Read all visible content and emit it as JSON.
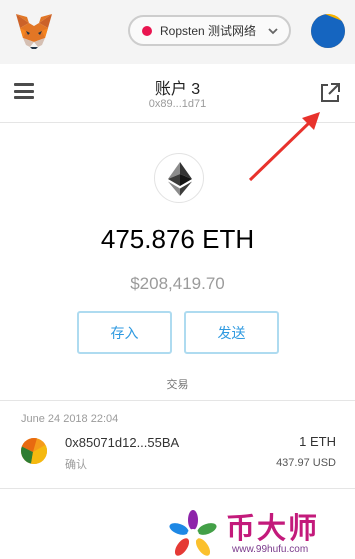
{
  "topbar": {
    "network_label": "Ropsten 测试网络",
    "network_color": "#e91550",
    "fox_icon": "metamask-fox-icon",
    "identicon": "account-identicon"
  },
  "account": {
    "name": "账户 3",
    "address_short": "0x89...1d71"
  },
  "balance": {
    "eth": "475.876 ETH",
    "fiat": "$208,419.70"
  },
  "actions": {
    "deposit_label": "存入",
    "send_label": "发送"
  },
  "transactions": {
    "title": "交易",
    "items": [
      {
        "date": "June 24 2018 22:04",
        "address": "0x85071d12...55BA",
        "status": "确认",
        "amount": "1 ETH",
        "fiat": "437.97 USD"
      }
    ]
  },
  "watermark": {
    "title": "币大师",
    "url": "www.99hufu.com"
  },
  "colors": {
    "accent": "#2f9ae0",
    "button_border": "#aedbf0",
    "annotation_arrow": "#e8322c"
  }
}
